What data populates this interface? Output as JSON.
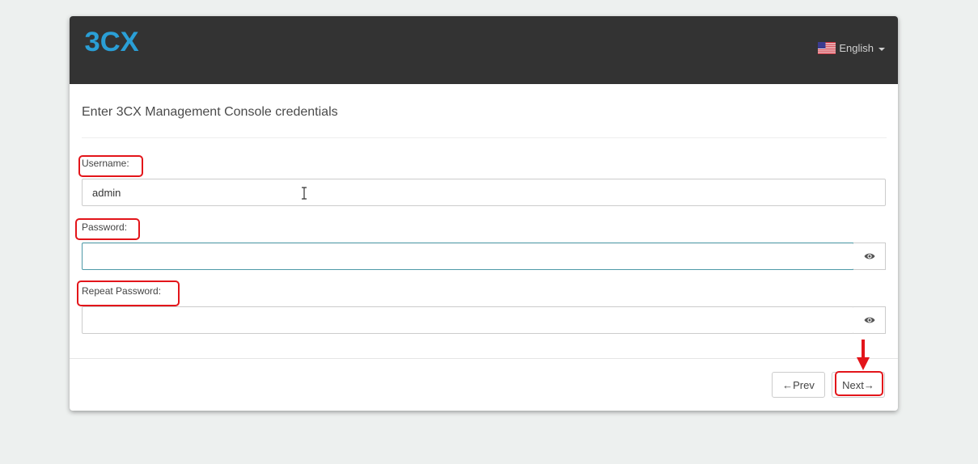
{
  "header": {
    "logo_text": "3CX",
    "language": "English"
  },
  "form": {
    "title": "Enter 3CX Management Console credentials",
    "username_label": "Username:",
    "username_value": "admin",
    "password_label": "Password:",
    "password_value": "",
    "repeat_password_label": "Repeat Password:",
    "repeat_password_value": ""
  },
  "buttons": {
    "prev_label": "←Prev",
    "next_label": "Next→"
  },
  "colors": {
    "header_bg": "#333333",
    "logo_blue": "#2a9fd6",
    "annotation_red": "#e3151a",
    "focus_border": "#4e9aa8"
  },
  "icons": {
    "reveal_password": "eye-icon",
    "language_flag": "us-flag-icon",
    "text_cursor": "text-cursor-icon",
    "annotation_arrow": "arrow-down-icon"
  }
}
